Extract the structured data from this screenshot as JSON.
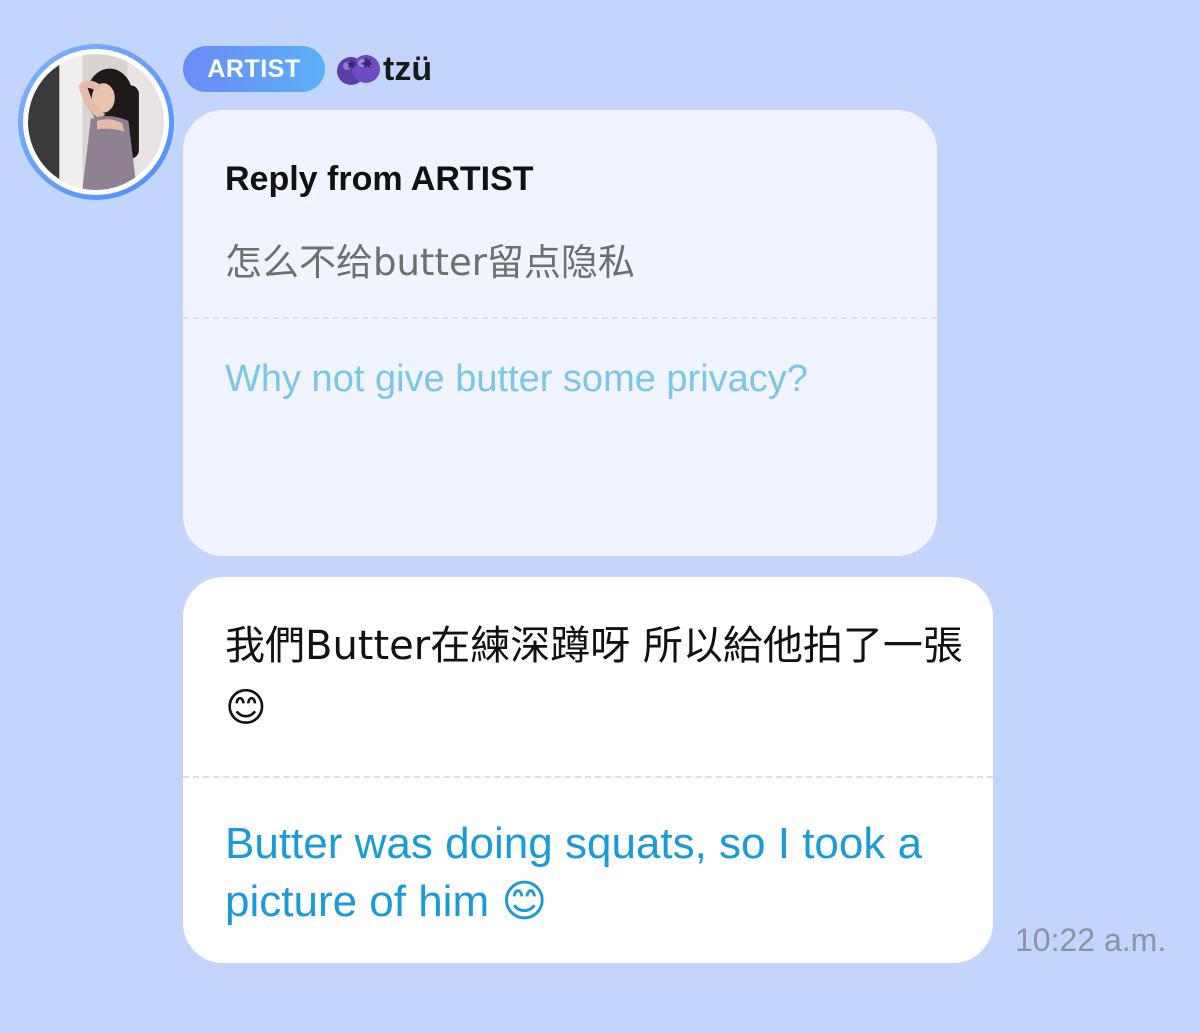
{
  "header": {
    "badge_label": "ARTIST",
    "artist_name": "tzü",
    "name_icon": "blueberry-icon",
    "avatar_icon": "artist-profile-photo"
  },
  "reply_bubble": {
    "title": "Reply from ARTIST",
    "original_text": "怎么不给butter留点隐私",
    "translated_text": "Why not give butter some privacy?"
  },
  "message_bubble": {
    "original_text": "我們Butter在練深蹲呀 所以給他拍了一張😊",
    "translated_text": "Butter was doing squats, so I took a picture of him 😊"
  },
  "timestamp": "10:22 a.m.",
  "colors": {
    "background": "#c3d5fd",
    "badge_gradient_start": "#6b8cf8",
    "badge_gradient_end": "#5bb0f5",
    "reply_bubble_bg": "#eff4ff",
    "message_bubble_bg": "#ffffff",
    "reply_translation_text": "#7cc6e6",
    "message_translation_text": "#1b9ad8",
    "avatar_ring": "#4f8df5"
  }
}
